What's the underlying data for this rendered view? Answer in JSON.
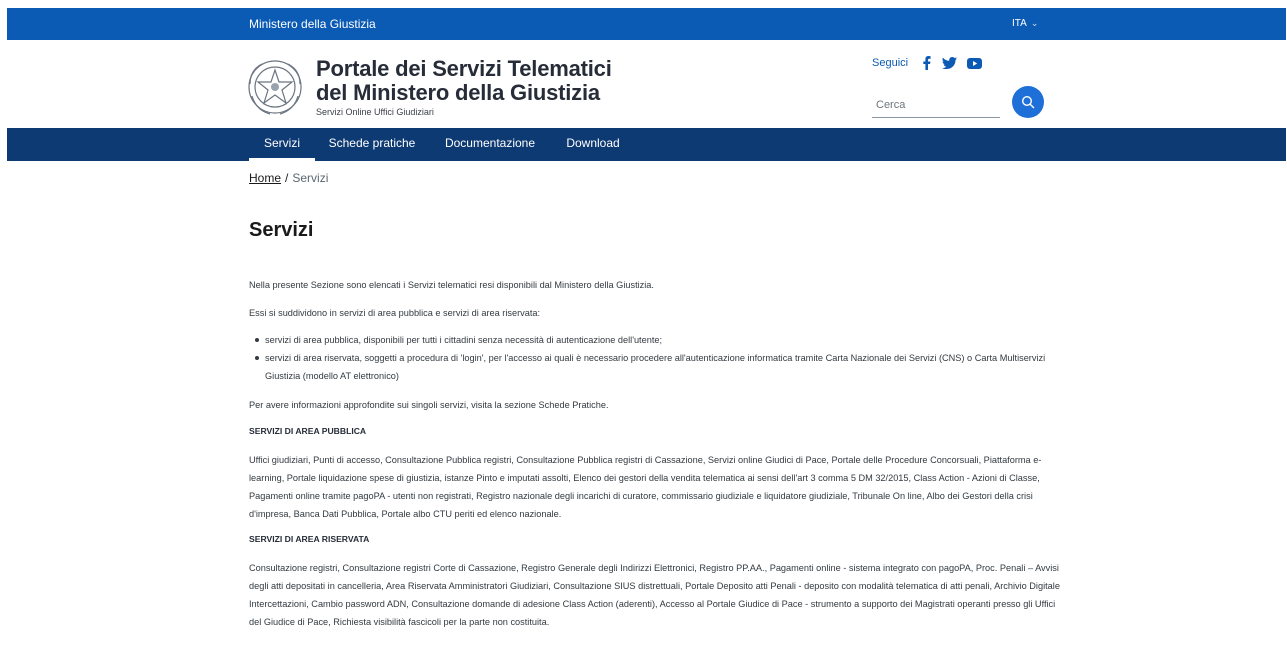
{
  "header": {
    "org": "Ministero della Giustizia",
    "lang": "ITA",
    "title_line1": "Portale dei Servizi Telematici",
    "title_line2": "del Ministero della Giustizia",
    "subtitle": "Servizi Online Uffici Giudiziari",
    "follow_label": "Seguici",
    "search_placeholder": "Cerca",
    "social": [
      "facebook-icon",
      "twitter-icon",
      "youtube-icon"
    ]
  },
  "nav": {
    "items": [
      {
        "label": "Servizi",
        "active": true
      },
      {
        "label": "Schede pratiche"
      },
      {
        "label": "Documentazione"
      },
      {
        "label": "Download"
      }
    ]
  },
  "breadcrumb": {
    "home": "Home",
    "separator": "/",
    "current": "Servizi"
  },
  "page": {
    "title": "Servizi",
    "intro": "Nella presente Sezione sono elencati i Servizi telematici resi disponibili dal Ministero della Giustizia.",
    "split": "Essi si suddividono in servizi di area pubblica e servizi di area riservata:",
    "list": [
      "servizi di area pubblica, disponibili per tutti i cittadini senza necessità di autenticazione dell'utente;",
      "servizi di area riservata, soggetti a procedura di 'login', per l'accesso ai quali è necessario procedere all'autenticazione informatica tramite Carta Nazionale dei Servizi (CNS) o Carta Multiservizi Giustizia (modello AT elettronico)"
    ],
    "more": "Per avere informazioni approfondite sui singoli servizi, visita la sezione Schede Pratiche.",
    "pub_heading": "SERVIZI DI AREA PUBBLICA",
    "pub_text": "Uffici giudiziari, Punti di accesso, Consultazione Pubblica registri, Consultazione Pubblica registri di Cassazione, Servizi online Giudici di Pace, Portale delle Procedure Concorsuali, Piattaforma e-learning, Portale liquidazione spese di giustizia, istanze Pinto e imputati assolti, Elenco dei gestori della vendita telematica ai sensi dell'art 3 comma 5 DM 32/2015, Class Action - Azioni di Classe, Pagamenti online tramite pagoPA - utenti non registrati, Registro nazionale degli incarichi di curatore, commissario giudiziale e liquidatore giudiziale, Tribunale On line, Albo dei Gestori della crisi d'impresa, Banca Dati Pubblica, Portale albo CTU periti ed elenco nazionale.",
    "ris_heading": "SERVIZI DI AREA RISERVATA",
    "ris_text": "Consultazione registri, Consultazione registri Corte di Cassazione, Registro Generale degli Indirizzi Elettronici, Registro PP.AA., Pagamenti online - sistema integrato con pagoPA, Proc. Penali – Avvisi degli atti depositati in cancelleria, Area Riservata Amministratori Giudiziari, Consultazione SIUS distrettuali, Portale Deposito atti Penali - deposito con modalità telematica di atti penali, Archivio Digitale Intercettazioni, Cambio password ADN, Consultazione domande di adesione Class Action (aderenti), Accesso al Portale Giudice di Pace - strumento a supporto dei Magistrati operanti presso gli Uffici del Giudice di Pace, Richiesta visibilità fascicoli per la parte non costituita."
  },
  "colors": {
    "slim_header": "#0b5ab4",
    "navbar": "#0d3a73",
    "search_button": "#1f6fd8"
  }
}
